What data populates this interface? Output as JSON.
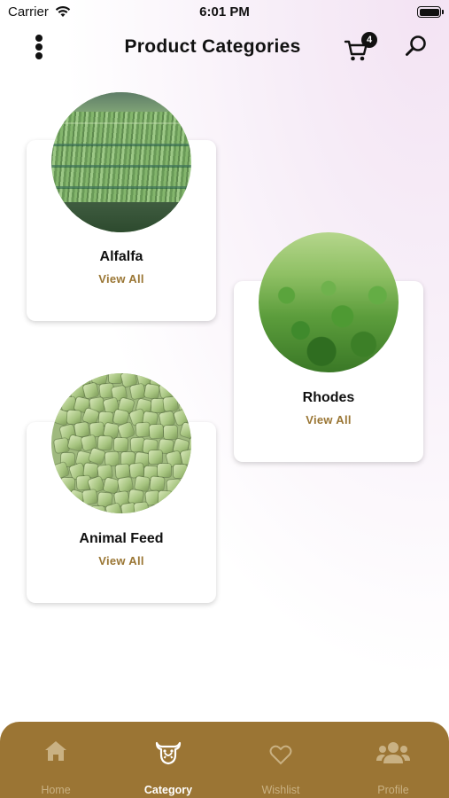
{
  "status_bar": {
    "carrier": "Carrier",
    "time": "6:01 PM"
  },
  "header": {
    "title": "Product Categories",
    "cart_count": "4"
  },
  "categories": [
    {
      "name": "Alfalfa",
      "link": "View All"
    },
    {
      "name": "Rhodes",
      "link": "View All"
    },
    {
      "name": "Animal Feed",
      "link": "View All"
    }
  ],
  "tabs": [
    {
      "label": "Home",
      "icon": "home-icon"
    },
    {
      "label": "Category",
      "icon": "cow-icon"
    },
    {
      "label": "Wishlist",
      "icon": "heart-icon"
    },
    {
      "label": "Profile",
      "icon": "users-icon"
    }
  ],
  "colors": {
    "accent": "#9b7534",
    "link": "#9a7634",
    "tab_inactive": "#c9b183"
  }
}
